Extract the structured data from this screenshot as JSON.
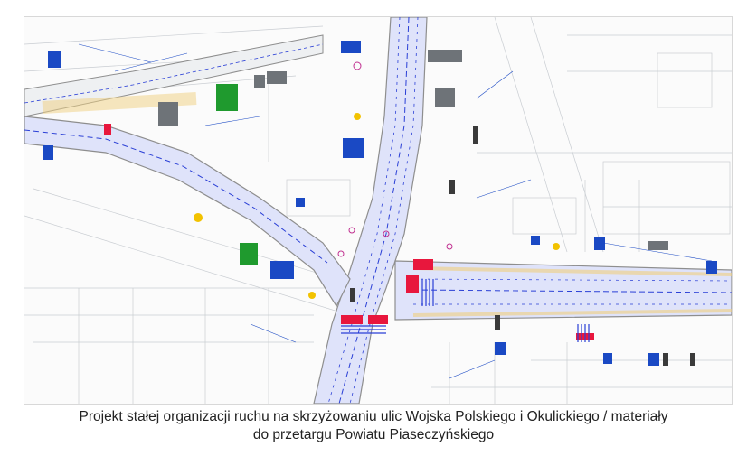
{
  "image": {
    "alt": "Projekt stałej organizacji ruchu na skrzyżowaniu ulic Wojska Polskiego i Okulickiego"
  },
  "caption": {
    "line1": "Projekt stałej organizacji ruchu na skrzyżowaniu ulic Wojska Polskiego i Okulickiego / materiały",
    "line2": "do przetargu Powiatu Piaseczyńskiego"
  },
  "colors": {
    "road_fill": "#dfe3fa",
    "road_edge": "#8e8e8e",
    "lane_marking": "#2a3fd6",
    "crossing": "#e8173d",
    "sign_blue": "#1a49c4",
    "sign_green": "#1f9a2e",
    "sign_yellow": "#f2c200",
    "linework": "#9aa0a6",
    "caption_text": "#222222"
  },
  "icons": [
    "road-sign-icon",
    "traffic-light-icon",
    "crosswalk-icon"
  ]
}
